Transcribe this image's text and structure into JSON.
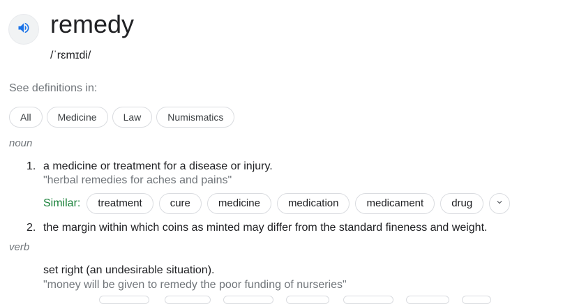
{
  "entry": {
    "word": "remedy",
    "pronunciation": "/ˈrɛmɪdi/",
    "speaker_icon": "speaker-icon"
  },
  "see_definitions": {
    "label": "See definitions in:",
    "chips": [
      "All",
      "Medicine",
      "Law",
      "Numismatics"
    ]
  },
  "noun": {
    "label": "noun",
    "senses": [
      {
        "number": "1.",
        "definition": "a medicine or treatment for a disease or injury.",
        "example": "\"herbal remedies for aches and pains\"",
        "similar_label": "Similar:",
        "similar": [
          "treatment",
          "cure",
          "medicine",
          "medication",
          "medicament",
          "drug"
        ],
        "expand_icon": "chevron-down-icon"
      },
      {
        "number": "2.",
        "definition": "the margin within which coins as minted may differ from the standard fineness and weight."
      }
    ]
  },
  "verb": {
    "label": "verb",
    "senses": [
      {
        "definition": "set right (an undesirable situation).",
        "example": "\"money will be given to remedy the poor funding of nurseries\""
      }
    ]
  }
}
